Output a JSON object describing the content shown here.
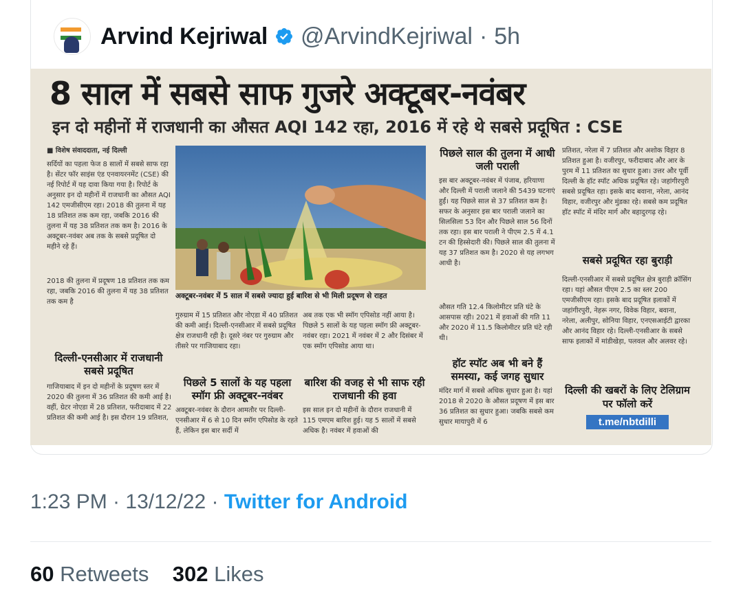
{
  "tweet": {
    "author_name": "Arvind Kejriwal",
    "author_handle": "@ArvindKejriwal",
    "age": "5h",
    "separator": "·",
    "timestamp": "1:23 PM · 13/12/22 ·",
    "source": "Twitter for Android",
    "retweets_count": "60",
    "retweets_label": "Retweets",
    "likes_count": "302",
    "likes_label": "Likes",
    "icons": {
      "verified": "verified-badge-icon",
      "avatar": "profile-avatar"
    },
    "colors": {
      "link": "#1d9bf0",
      "muted": "#536471",
      "verified": "#1d9bf0"
    }
  },
  "newspaper": {
    "headline": "8 साल में सबसे साफ गुजरे अक्टूबर-नवंबर",
    "subheadline": "इन दो महीनों में राजधानी का औसत AQI 142 रहा, 2016 में रहे थे सबसे प्रदूषित : CSE",
    "byline": "■ विशेष संवाददाता, नई दिल्ली",
    "col1_text": "सर्दियों का पहला फेज 8 सालों में सबसे साफ रहा है। सेंटर फॉर साइंस एंड एनवायरनमेंट (CSE) की नई रिपोर्ट में यह दावा किया गया है। रिपोर्ट के अनुसार इन दो महीनों में राजधानी का औसत AQI 142 एमजीसीएम रहा। 2018 की तुलना में यह 18 प्रतिशत तक कम रहा, जबकि 2016 की तुलना में यह 38 प्रतिशत तक कम है। 2016 के अक्टूबर-नवंबर अब तक के सबसे प्रदूषित दो महीने रहे हैं।",
    "pull_quote": "2018 की तुलना में प्रदूषण 18 प्रतिशत तक कम रहा, जबकि 2016 की तुलना में यह 38 प्रतिशत तक कम है",
    "col1_heading": "दिल्ली-एनसीआर में राजधानी सबसे प्रदूषित",
    "col1_text2": "गाजियाबाद में इन दो महीनों के प्रदूषण स्तर में 2020 की तुलना में 36 प्रतिशत की कमी आई है। वहीं, ग्रेटर नोएडा में 28 प्रतिशत, फरीदाबाद में 22 प्रतिशत की कमी आई है। इस दौरान 19 प्रतिशत,",
    "photo_caption": "अक्टूबर-नवंबर में 5 साल में सबसे ज्यादा हुई बारिश से भी मिली प्रदूषण से राहत",
    "col2_text": "गुरुग्राम में 15 प्रतिशत और नोएडा में 40 प्रतिशत की कमी आई। दिल्ली-एनसीआर में सबसे प्रदूषित क्षेत्र राजधानी रही है। दूसरे नंबर पर गुरुग्राम और तीसरे पर गाजियाबाद रहा।",
    "col2_heading": "पिछले 5 सालों के यह पहला स्मॉग फ्री अक्टूबर-नवंबर",
    "col2_text2": "अक्टूबर-नवंबर के दौरान आमतौर पर दिल्ली-एनसीआर में 6 से 10 दिन स्मॉग एपिसोड के रहते हैं, लेकिन इस बार सर्दी में",
    "col3_text": "अब तक एक भी स्मॉग एपिसोड नहीं आया है। पिछले 5 सालों के यह पहला स्मॉग फ्री अक्टूबर-नवंबर रहा। 2021 में नवंबर में 2 और दिसंबर में एक स्मॉग एपिसोड आया था।",
    "col3_heading": "बारिश की वजह से भी साफ रही राजधानी की हवा",
    "col3_text2": "इस साल इन दो महीनों के दौरान राजधानी में 115 एमएम बारिश हुई। यह 5 सालों में सबसे अधिक है। नवंबर में हवाओं की",
    "col4_heading": "पिछले साल की तुलना में आधी जली पराली",
    "col4_text": "इस बार अक्टूबर-नवंबर में पंजाब, हरियाणा और दिल्ली में पराली जलाने की 5439 घटनाएं हुईं। यह पिछले साल से 37 प्रतिशत कम है। सफर के अनुसार इस बार पराली जलाने का सिलसिला 53 दिन और पिछले साल 56 दिनों तक रहा। इस बार पराली ने पीएम 2.5 में 4.1 टन की हिस्सेदारी की। पिछले साल की तुलना में यह 37 प्रतिशत कम है। 2020 से यह लगभग आधी है।",
    "col4_text2": "औसत गति 12.4 किलोमीटर प्रति घंटे के आसपास रही। 2021 में हवाओं की गति 11 और 2020 में 11.5 किलोमीटर प्रति घंटे रही थी।",
    "col4_heading2": "हॉट स्पॉट अब भी बने हैं समस्या, कई जगह सुधार",
    "col4_text3": "मंदिर मार्ग में सबसे अधिक सुधार हुआ है। यहां 2018 से 2020 के औसत प्रदूषण में इस बार 36 प्रतिशत का सुधार हुआ। जबकि सबसे कम सुधार मायापुरी में 6",
    "col5_text": "प्रतिशत, नरेला में 7 प्रतिशत और अशोक विहार 8 प्रतिशत हुआ है। वजीरपुर, फरीदाबाद और आर के पुरम में 11 प्रतिशत का सुधार हुआ। उत्तर और पूर्वी दिल्ली के हॉट स्पॉट अधिक प्रदूषित रहे। जहांगीरपुरी सबसे प्रदूषित रहा। इसके बाद बवाना, नरेला, आनंद विहार, वजीरपुर और मुंडका रहे। सबसे कम प्रदूषित हॉट स्पॉट में मंदिर मार्ग और बहादुरगढ़ रहे।",
    "col5_heading": "सबसे प्रदूषित रहा बुराड़ी",
    "col5_text2": "दिल्ली-एनसीआर में सबसे प्रदूषित क्षेत्र बुराड़ी क्रॉसिंग रहा। यहां औसत पीएम 2.5 का स्तर 200 एमजीसीएम रहा। इसके बाद प्रदूषित इलाकों में जहांगीरपुरी, नेहरू नगर, विवेक विहार, बवाना, नरेला, अलीपुर, सोनिया विहार, एनएसआईटी द्वारका और आनंद विहार रहे। दिल्ली-एनसीआर के सबसे साफ इलाकों में मांडीखेड़ा, पलवल और अलवर रहे।",
    "telegram_promo": "दिल्ली की खबरों के लिए टेलिग्राम पर फॉलो करें",
    "telegram_link": "t.me/nbtdilli"
  }
}
